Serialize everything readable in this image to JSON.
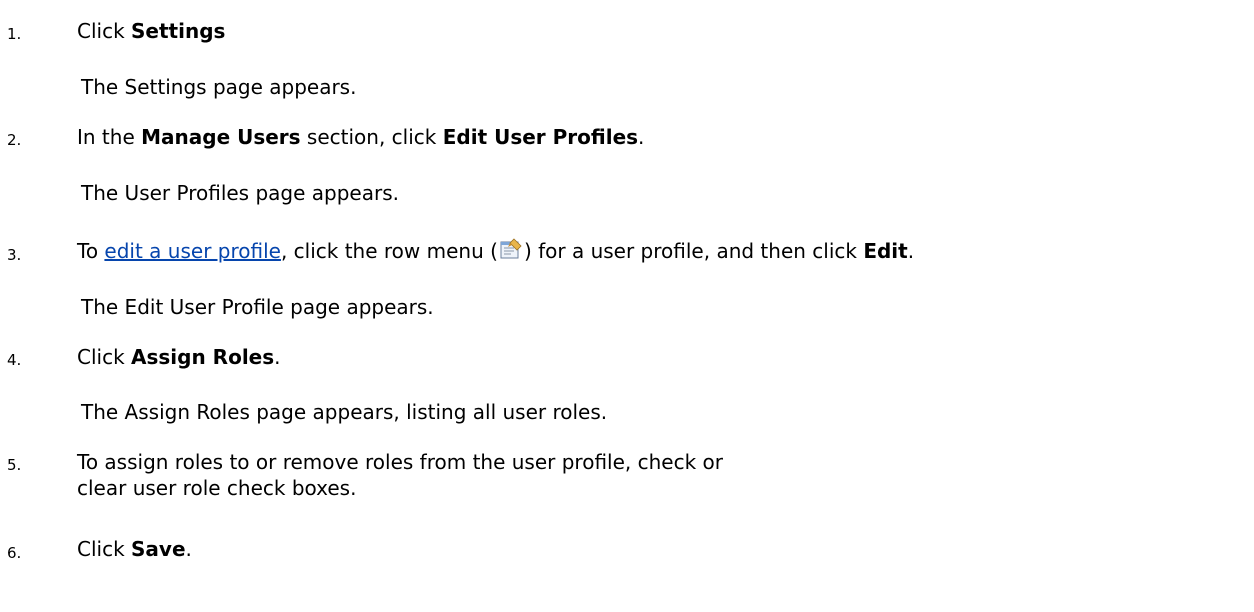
{
  "steps": [
    {
      "number": "1.",
      "parts": [
        "Click ",
        "Settings"
      ],
      "result": "The Settings page appears."
    },
    {
      "number": "2.",
      "parts": [
        "In the ",
        "Manage Users",
        " section, click ",
        "Edit User Profiles",
        "."
      ],
      "result": "The User Profiles page appears."
    },
    {
      "number": "3.",
      "parts": [
        "To ",
        "edit a user profile",
        ", click the row menu (",
        ") for a user profile, and then click ",
        "Edit",
        "."
      ],
      "result": "The Edit User Profile page appears."
    },
    {
      "number": "4.",
      "parts": [
        "Click ",
        "Assign Roles",
        "."
      ],
      "result": "The Assign Roles page appears, listing all user roles."
    },
    {
      "number": "5.",
      "parts": [
        "To assign roles to or remove roles from the user profile, check or clear user role check boxes."
      ]
    },
    {
      "number": "6.",
      "parts": [
        "Click ",
        "Save",
        "."
      ]
    }
  ],
  "icons": {
    "row_menu": "row-menu-icon"
  },
  "colors": {
    "link": "#0645ad",
    "text": "#000000"
  }
}
